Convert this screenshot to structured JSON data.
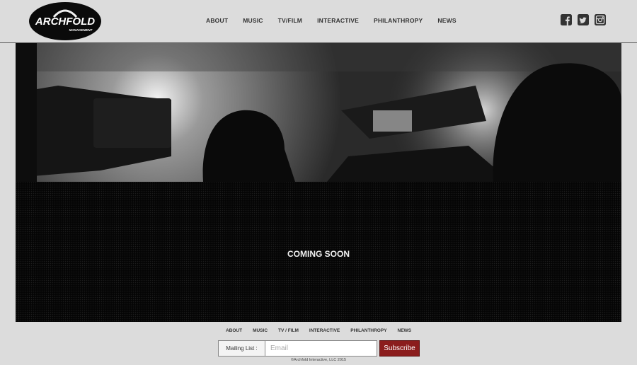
{
  "header": {
    "logo": {
      "text": "ARCHFOLD",
      "subtext": "MANAGEMENT"
    },
    "nav": [
      {
        "label": "ABOUT"
      },
      {
        "label": "MUSIC"
      },
      {
        "label": "TV/FILM"
      },
      {
        "label": "INTERACTIVE"
      },
      {
        "label": "PHILANTHROPY"
      },
      {
        "label": "NEWS"
      }
    ],
    "social": [
      {
        "icon": "facebook-icon"
      },
      {
        "icon": "twitter-icon"
      },
      {
        "icon": "instagram-icon"
      }
    ]
  },
  "hero": {
    "description_icon": "broadcast-camera-crew-photo"
  },
  "content": {
    "message": "COMING SOON"
  },
  "footer": {
    "nav": [
      {
        "label": "ABOUT"
      },
      {
        "label": "MUSIC"
      },
      {
        "label": "TV / FILM"
      },
      {
        "label": "INTERACTIVE"
      },
      {
        "label": "PHILANTHROPY"
      },
      {
        "label": "NEWS"
      }
    ],
    "mailing_label": "Mailing List :",
    "email_placeholder": "Email",
    "email_value": "",
    "subscribe_label": "Subscribe",
    "copyright": "©Archfold Interactive, LLC 2015"
  },
  "colors": {
    "accent": "#8b1d1d",
    "background": "#dcdcdc",
    "content_bg": "#050505"
  }
}
